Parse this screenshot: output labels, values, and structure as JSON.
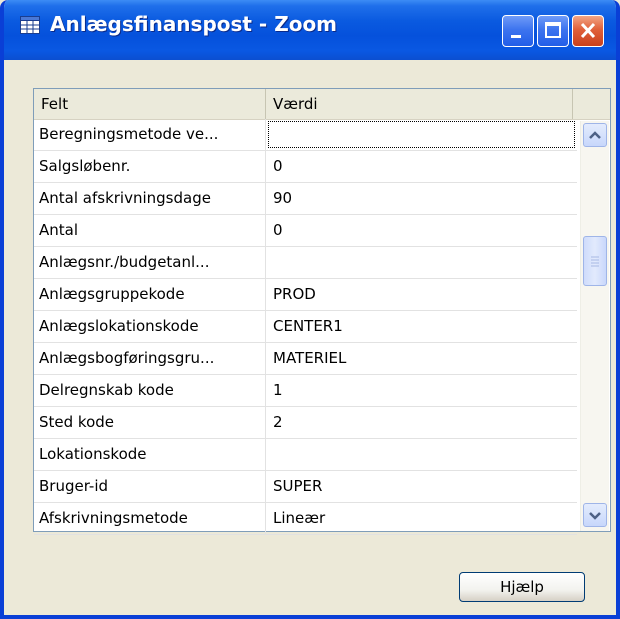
{
  "window": {
    "title": "Anlægsfinanspost - Zoom",
    "title_icon": "table-icon",
    "controls": [
      "minimize-icon",
      "maximize-icon",
      "close-icon"
    ]
  },
  "grid": {
    "columns": [
      "Felt",
      "Værdi"
    ],
    "rows": [
      {
        "field": "Beregningsmetode ve...",
        "value": ""
      },
      {
        "field": "Salgsløbenr.",
        "value": "0"
      },
      {
        "field": "Antal afskrivningsdage",
        "value": "90"
      },
      {
        "field": "Antal",
        "value": "0"
      },
      {
        "field": "Anlægsnr./budgetanl...",
        "value": ""
      },
      {
        "field": "Anlægsgruppekode",
        "value": "PROD"
      },
      {
        "field": "Anlægslokationskode",
        "value": "CENTER1"
      },
      {
        "field": "Anlægsbogføringsgru...",
        "value": "MATERIEL"
      },
      {
        "field": "Delregnskab kode",
        "value": "1"
      },
      {
        "field": "Sted kode",
        "value": "2"
      },
      {
        "field": "Lokationskode",
        "value": ""
      },
      {
        "field": "Bruger-id",
        "value": "SUPER"
      },
      {
        "field": "Afskrivningsmetode",
        "value": "Lineær"
      }
    ],
    "selected_row": 0
  },
  "buttons": {
    "help": "Hjælp"
  },
  "colors": {
    "titlebar": "#0551dc",
    "window_bg": "#ece9d8",
    "close_button": "#e0603a"
  }
}
